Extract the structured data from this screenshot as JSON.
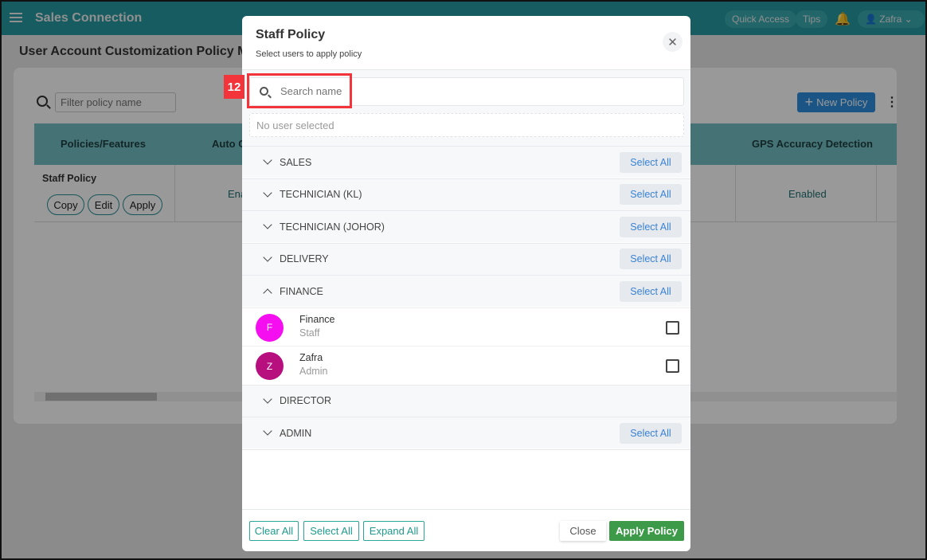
{
  "header": {
    "app_name": "Sales Connection",
    "quick_access": "Quick Access",
    "tips": "Tips",
    "user": "Zafra"
  },
  "page": {
    "title": "User Account Customization Policy Management",
    "filter_placeholder": "Filter policy name",
    "new_policy": "New Policy",
    "table": {
      "headers": [
        "Policies/Features",
        "Auto C",
        "GPS Accuracy Detection"
      ],
      "row": {
        "name": "Staff Policy",
        "copy": "Copy",
        "edit": "Edit",
        "apply": "Apply",
        "cells": [
          "Ena",
          "Enabled"
        ]
      }
    }
  },
  "annotation": {
    "label": "12",
    "color": "#f3343a"
  },
  "modal": {
    "title": "Staff Policy",
    "subtitle": "Select users to apply policy",
    "search_placeholder": "Search name",
    "no_selection": "No user selected",
    "select_all_label": "Select All",
    "groups": [
      {
        "name": "SALES",
        "expanded": false,
        "has_select_all": true
      },
      {
        "name": "TECHNICIAN (KL)",
        "expanded": false,
        "has_select_all": true
      },
      {
        "name": "TECHNICIAN (JOHOR)",
        "expanded": false,
        "has_select_all": true
      },
      {
        "name": "DELIVERY",
        "expanded": false,
        "has_select_all": true
      },
      {
        "name": "FINANCE",
        "expanded": true,
        "has_select_all": true,
        "users": [
          {
            "initial": "F",
            "name": "Finance",
            "role": "Staff",
            "color": "#f40ef0",
            "checked": false
          },
          {
            "initial": "Z",
            "name": "Zafra",
            "role": "Admin",
            "color": "#b80f7f",
            "checked": false
          }
        ]
      },
      {
        "name": "DIRECTOR",
        "expanded": false,
        "has_select_all": false
      },
      {
        "name": "ADMIN",
        "expanded": false,
        "has_select_all": true
      }
    ],
    "footer": {
      "clear_all": "Clear All",
      "select_all": "Select All",
      "expand_all": "Expand All",
      "close": "Close",
      "apply_policy": "Apply Policy"
    }
  }
}
